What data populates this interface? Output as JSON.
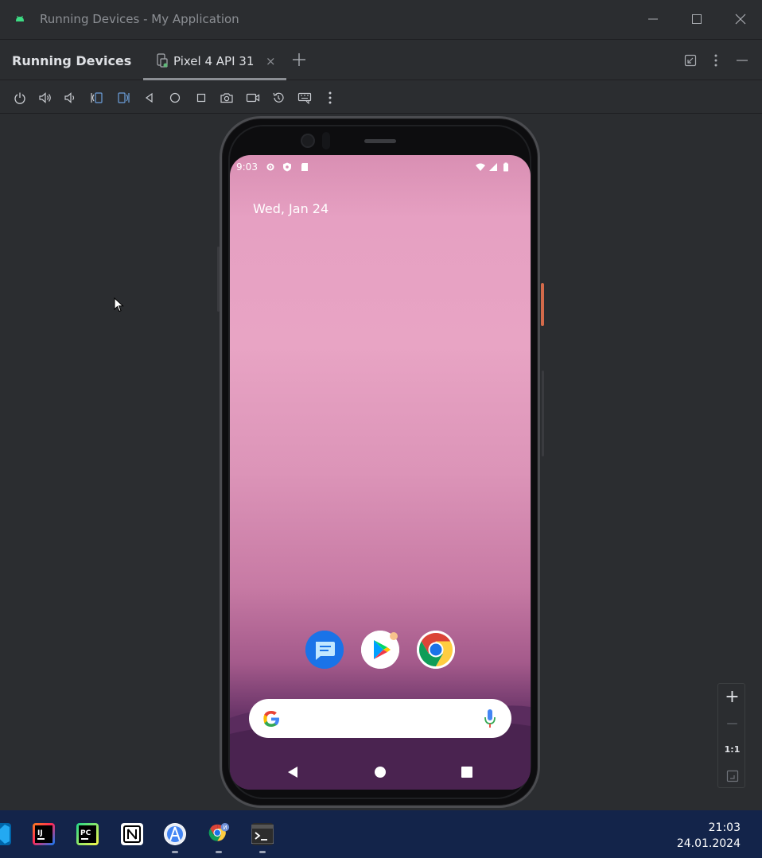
{
  "window": {
    "title": "Running Devices - My Application"
  },
  "tool_window": {
    "title": "Running Devices",
    "tabs": [
      {
        "label": "Pixel 4 API 31",
        "close": "×"
      }
    ],
    "add_tab": "+"
  },
  "device_toolbar": {
    "items": [
      "power",
      "volume-up",
      "volume-down",
      "rotate-left",
      "rotate-right",
      "back",
      "home",
      "overview",
      "screenshot",
      "screen-record",
      "reset-snapshot",
      "keyboard",
      "more"
    ]
  },
  "device": {
    "status_bar": {
      "time": "9:03"
    },
    "date_widget": "Wed, Jan 24",
    "dock_apps": [
      "Messages",
      "Play Store",
      "Chrome"
    ]
  },
  "zoom_controls": {
    "zoom_in": "+",
    "zoom_out": "—",
    "actual_size": "1:1"
  },
  "taskbar": {
    "apps": [
      "VS Code",
      "IntelliJ IDEA",
      "PyCharm",
      "Notion",
      "Android Studio",
      "Chrome",
      "Terminal"
    ],
    "clock_time": "21:03",
    "clock_date": "24.01.2024"
  }
}
